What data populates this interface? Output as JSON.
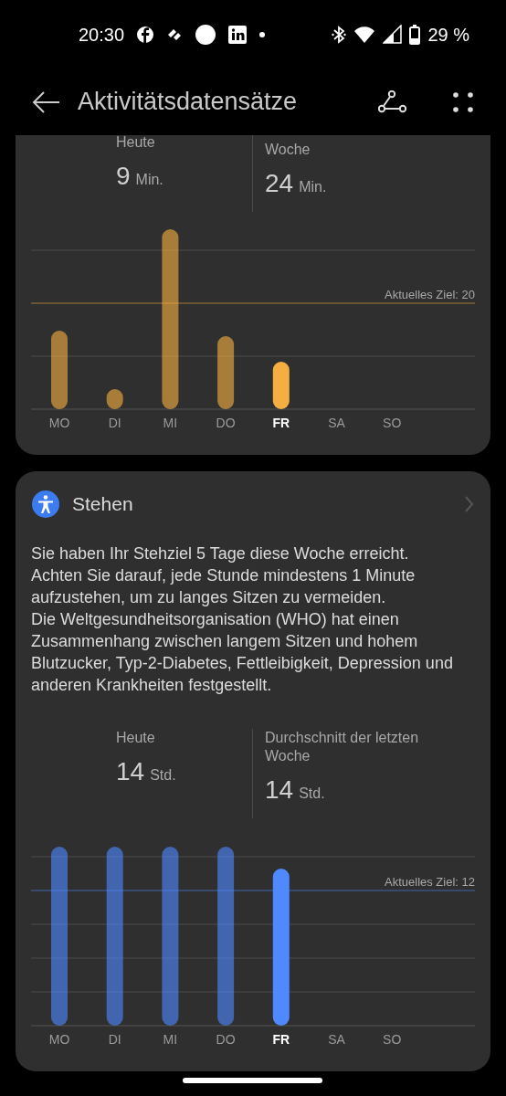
{
  "status_bar": {
    "time": "20:30",
    "battery": "29 %"
  },
  "header": {
    "title": "Aktivitätsdatensätze"
  },
  "cards": [
    {
      "color": "#f4ae41",
      "stats": [
        {
          "label": "Heute",
          "value": "9",
          "unit": "Min."
        },
        {
          "label": "Woche",
          "value": "24",
          "unit": "Min."
        }
      ],
      "goal": "Aktuelles Ziel: 20",
      "days": [
        {
          "label": "MO",
          "selected": false
        },
        {
          "label": "DI",
          "selected": false
        },
        {
          "label": "MI",
          "selected": false
        },
        {
          "label": "DO",
          "selected": false
        },
        {
          "label": "FR",
          "selected": true
        },
        {
          "label": "SA",
          "selected": false
        },
        {
          "label": "SO",
          "selected": false
        }
      ]
    },
    {
      "color": "#4f88ff",
      "title": "Stehen",
      "paragraphs": [
        "Sie haben Ihr Stehziel 5 Tage diese Woche erreicht. Achten Sie darauf, jede Stunde mindestens 1 Minute aufzustehen, um zu langes Sitzen zu vermeiden.",
        "Die Weltgesundheitsorganisation (WHO) hat einen Zusammenhang zwischen langem Sitzen und hohem Blutzucker, Typ-2-Diabetes, Fettleibigkeit, Depression und anderen Krankheiten festgestellt."
      ],
      "stats": [
        {
          "label": "Heute",
          "value": "14",
          "unit": "Std."
        },
        {
          "label": "Durchschnitt der letzten Woche",
          "value": "14",
          "unit": "Std."
        }
      ],
      "goal": "Aktuelles Ziel: 12",
      "days": [
        {
          "label": "MO",
          "selected": false
        },
        {
          "label": "DI",
          "selected": false
        },
        {
          "label": "MI",
          "selected": false
        },
        {
          "label": "DO",
          "selected": false
        },
        {
          "label": "FR",
          "selected": true
        },
        {
          "label": "SA",
          "selected": false
        },
        {
          "label": "SO",
          "selected": false
        }
      ]
    }
  ]
}
